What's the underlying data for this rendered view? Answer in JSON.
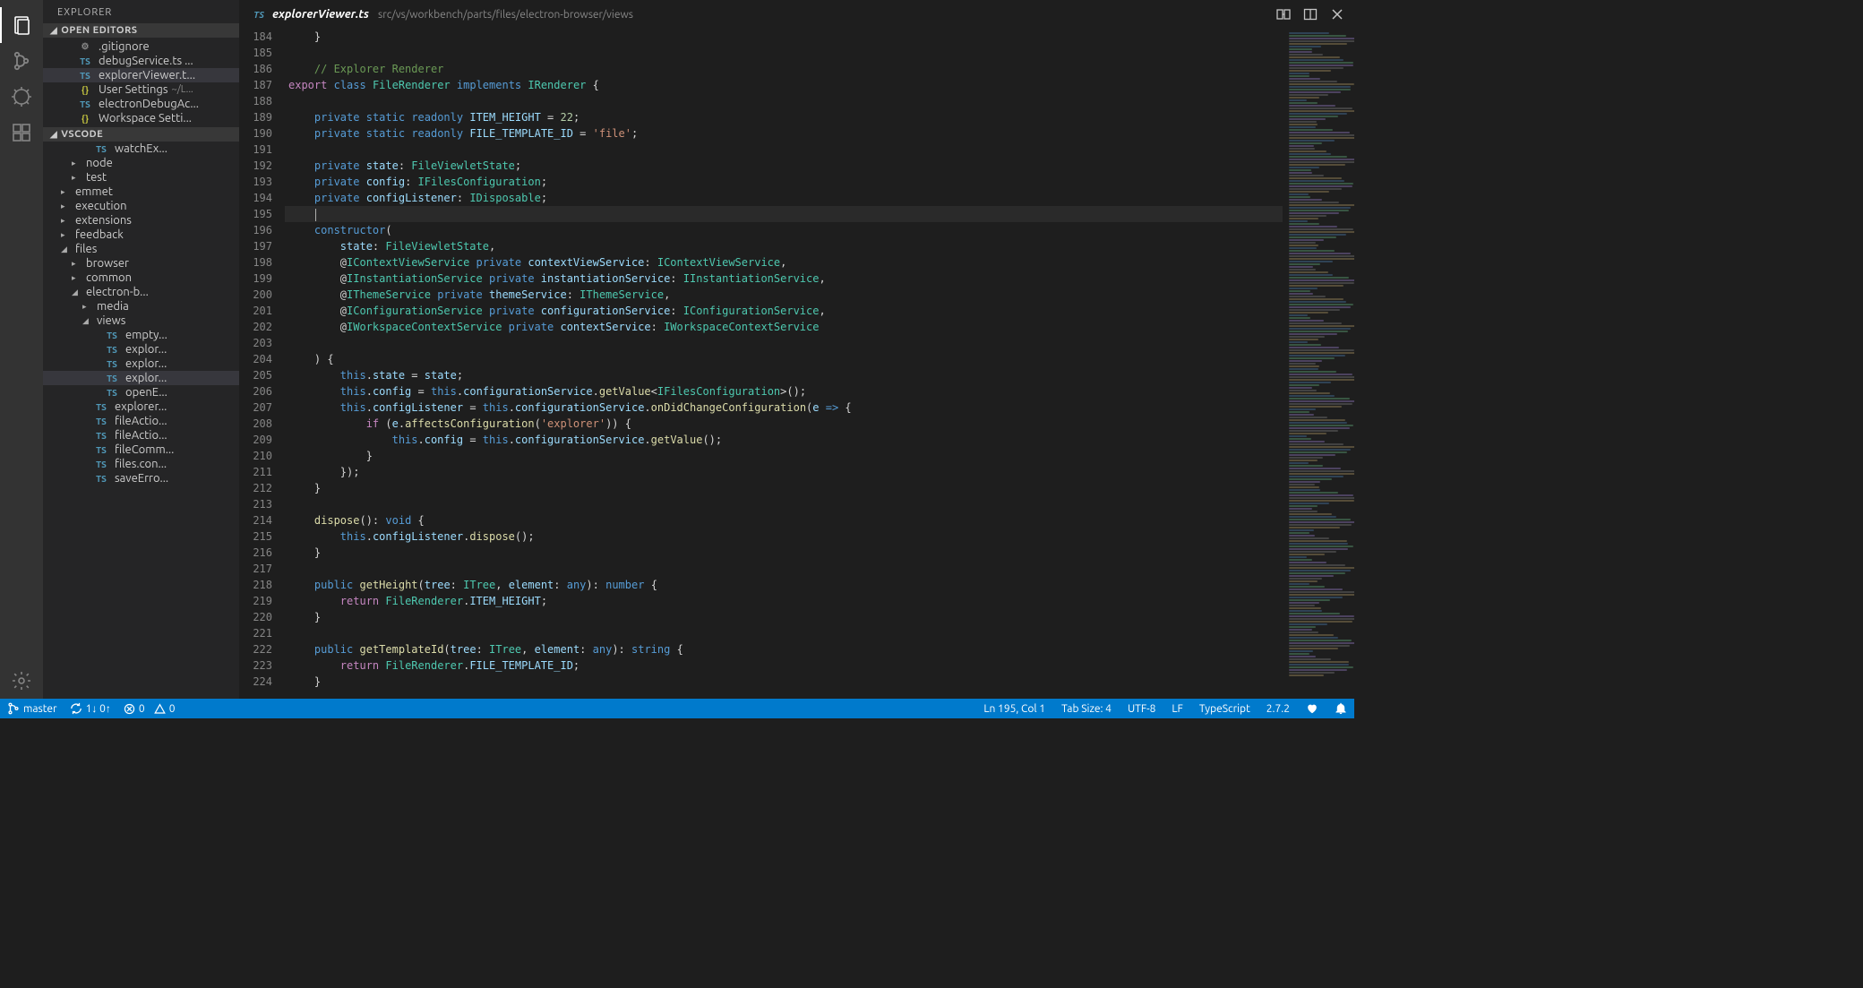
{
  "sidebar": {
    "title": "EXPLORER",
    "open_editors_header": "OPEN EDITORS",
    "open_editors": [
      {
        "icon": "gear",
        "iconText": "⚙",
        "name": ".gitignore",
        "active": false,
        "dirty": false
      },
      {
        "icon": "ts",
        "iconText": "TS",
        "name": "debugService.ts ...",
        "active": false,
        "dirty": false
      },
      {
        "icon": "ts",
        "iconText": "TS",
        "name": "explorerViewer.t...",
        "active": true,
        "dirty": false
      },
      {
        "icon": "json",
        "iconText": "{}",
        "name": "User Settings",
        "path": "~/L...",
        "active": false,
        "dirty": false
      },
      {
        "icon": "ts",
        "iconText": "TS",
        "name": "electronDebugAc...",
        "active": false,
        "dirty": false
      },
      {
        "icon": "json",
        "iconText": "{}",
        "name": "Workspace Setti...",
        "active": false,
        "dirty": false
      }
    ],
    "workspace_header": "VSCODE",
    "tree": [
      {
        "indent": 3,
        "icon": "ts",
        "iconText": "TS",
        "name": "watchEx...",
        "chev": ""
      },
      {
        "indent": 2,
        "icon": "",
        "iconText": "",
        "name": "node",
        "chev": "▸"
      },
      {
        "indent": 2,
        "icon": "",
        "iconText": "",
        "name": "test",
        "chev": "▸"
      },
      {
        "indent": 1,
        "icon": "",
        "iconText": "",
        "name": "emmet",
        "chev": "▸"
      },
      {
        "indent": 1,
        "icon": "",
        "iconText": "",
        "name": "execution",
        "chev": "▸"
      },
      {
        "indent": 1,
        "icon": "",
        "iconText": "",
        "name": "extensions",
        "chev": "▸"
      },
      {
        "indent": 1,
        "icon": "",
        "iconText": "",
        "name": "feedback",
        "chev": "▸"
      },
      {
        "indent": 1,
        "icon": "",
        "iconText": "",
        "name": "files",
        "chev": "◢"
      },
      {
        "indent": 2,
        "icon": "",
        "iconText": "",
        "name": "browser",
        "chev": "▸"
      },
      {
        "indent": 2,
        "icon": "",
        "iconText": "",
        "name": "common",
        "chev": "▸"
      },
      {
        "indent": 2,
        "icon": "",
        "iconText": "",
        "name": "electron-b...",
        "chev": "◢"
      },
      {
        "indent": 3,
        "icon": "",
        "iconText": "",
        "name": "media",
        "chev": "▸"
      },
      {
        "indent": 3,
        "icon": "",
        "iconText": "",
        "name": "views",
        "chev": "◢"
      },
      {
        "indent": 4,
        "icon": "ts",
        "iconText": "TS",
        "name": "empty...",
        "chev": ""
      },
      {
        "indent": 4,
        "icon": "ts",
        "iconText": "TS",
        "name": "explor...",
        "chev": ""
      },
      {
        "indent": 4,
        "icon": "ts",
        "iconText": "TS",
        "name": "explor...",
        "chev": ""
      },
      {
        "indent": 4,
        "icon": "ts",
        "iconText": "TS",
        "name": "explor...",
        "chev": "",
        "selected": true
      },
      {
        "indent": 4,
        "icon": "ts",
        "iconText": "TS",
        "name": "openE...",
        "chev": ""
      },
      {
        "indent": 3,
        "icon": "ts",
        "iconText": "TS",
        "name": "explorer...",
        "chev": ""
      },
      {
        "indent": 3,
        "icon": "ts",
        "iconText": "TS",
        "name": "fileActio...",
        "chev": ""
      },
      {
        "indent": 3,
        "icon": "ts",
        "iconText": "TS",
        "name": "fileActio...",
        "chev": ""
      },
      {
        "indent": 3,
        "icon": "ts",
        "iconText": "TS",
        "name": "fileComm...",
        "chev": ""
      },
      {
        "indent": 3,
        "icon": "ts",
        "iconText": "TS",
        "name": "files.con...",
        "chev": ""
      },
      {
        "indent": 3,
        "icon": "ts",
        "iconText": "TS",
        "name": "saveErro...",
        "chev": ""
      }
    ]
  },
  "tab": {
    "icon": "TS",
    "title": "explorerViewer.ts",
    "path": "src/vs/workbench/parts/files/electron-browser/views"
  },
  "editor": {
    "first_line": 184,
    "highlight_line": 195
  },
  "statusbar": {
    "branch": "master",
    "sync": "1↓ 0↑",
    "errors": "0",
    "warnings": "0",
    "cursor": "Ln 195, Col 1",
    "tabsize": "Tab Size: 4",
    "encoding": "UTF-8",
    "eol": "LF",
    "lang": "TypeScript",
    "ts_version": "2.7.2"
  }
}
